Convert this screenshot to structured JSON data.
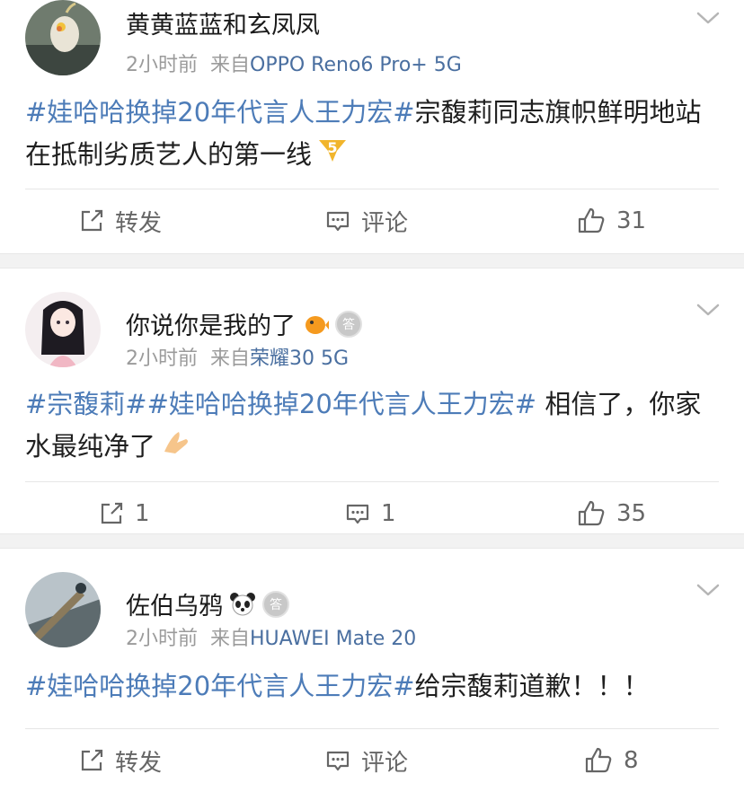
{
  "posts": [
    {
      "username": "黄黄蓝蓝和玄凤凤",
      "time": "2小时前",
      "from_prefix": "来自",
      "device": "OPPO Reno6 Pro+ 5G",
      "content": {
        "tag": "#娃哈哈换掉20年代言人王力宏#",
        "text": "宗馥莉同志旗帜鲜明地站在抵制劣质艺人的第一线"
      },
      "actions": {
        "repost": "转发",
        "comment": "评论",
        "like": "31"
      }
    },
    {
      "username": "你说你是我的了",
      "badge_text": "答",
      "time": "2小时前",
      "from_prefix": "来自",
      "device": "荣耀30 5G",
      "content": {
        "tag": "#宗馥莉##娃哈哈换掉20年代言人王力宏#",
        "text": " 相信了，你家水最纯净了"
      },
      "actions": {
        "repost": "1",
        "comment": "1",
        "like": "35"
      }
    },
    {
      "username": "佐伯乌鸦",
      "badge_text": "答",
      "time": "2小时前",
      "from_prefix": "来自",
      "device": "HUAWEI Mate 20",
      "content": {
        "tag": "#娃哈哈换掉20年代言人王力宏#",
        "text": "给宗馥莉道歉！！！"
      },
      "actions": {
        "repost": "转发",
        "comment": "评论",
        "like": "8"
      }
    }
  ],
  "icons": [
    "chevron-down-icon",
    "repost-icon",
    "comment-icon",
    "like-icon",
    "emoji-5-icon",
    "emoji-pufferfish-icon",
    "emoji-panda-icon",
    "emoji-praying-hands-icon"
  ],
  "colors": {
    "topic": "#4d7cb8",
    "device": "#4a6fa0",
    "meta": "#9b9b9b",
    "separator": "#f2f2f2"
  }
}
